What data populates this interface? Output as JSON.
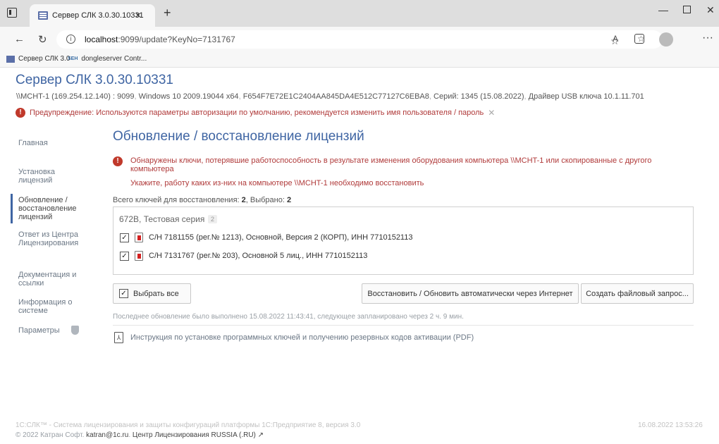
{
  "browser": {
    "tab_title": "Сервер СЛК 3.0.30.10331",
    "tab_close": "×",
    "new_tab": "+",
    "win_min": "—",
    "win_close": "✕",
    "url_host": "localhost",
    "url_rest": ":9099/update?KeyNo=7131767",
    "favorites": [
      {
        "label": "Сервер СЛК 3.0"
      },
      {
        "label": "dongleserver Contr..."
      }
    ]
  },
  "header": {
    "title": "Сервер СЛК 3.0.30.10331",
    "info_host": "\\\\MCHT-1 (169.254.12.140) : 9099",
    "info_os": "Windows 10 2009.19044 x64",
    "info_id": "F654F7E72E1C2404AA845DA4E512C77127C6EBA8",
    "info_serial": "Серий: 1345 (15.08.2022)",
    "info_driver": "Драйвер USB ключа 10.1.11.701",
    "warning": "Предупреждение: Используются параметры авторизации по умолчанию, рекомендуется изменить имя пользователя / пароль"
  },
  "sidebar": {
    "items": [
      {
        "label": "Главная"
      },
      {
        "label": "Установка лицензий"
      },
      {
        "label": "Обновление / восстановление лицензий"
      },
      {
        "label": "Ответ из Центра Лицензирования"
      },
      {
        "label": "Документация и ссылки"
      },
      {
        "label": "Информация о системе"
      },
      {
        "label": "Параметры"
      }
    ]
  },
  "main": {
    "title": "Обновление / восстановление лицензий",
    "alert_text": "Обнаружены ключи, потерявшие работоспособность в результате изменения оборудования компьютера \\\\MCHT-1 или скопированные с другого компьютера",
    "alert_instruction": "Укажите, работу каких из-них на компьютере \\\\MCHT-1 необходимо восстановить",
    "counts_prefix": "Всего ключей для восстановления: ",
    "counts_total": "2",
    "counts_mid": ", Выбрано: ",
    "counts_selected": "2",
    "series_name": "672B, Тестовая серия",
    "series_count": "2",
    "keys": [
      {
        "label": "С/Н 7181155 (рег.№ 1213), Основной, Версия 2 (КОРП), ИНН 7710152113",
        "checked": true
      },
      {
        "label": "С/Н 7131767 (рег.№ 203), Основной 5 лиц., ИНН 7710152113",
        "checked": true
      }
    ],
    "select_all_label": "Выбрать все",
    "restore_button": "Восстановить / Обновить автоматически через Интернет",
    "file_request_button": "Создать файловый запрос...",
    "last_update": "Последнее обновление было выполнено 15.08.2022 11:43:41, следующее запланировано через 2 ч. 9 мин.",
    "pdf_link": "Инструкция по установке программных ключей и получению резервных кодов активации (PDF)"
  },
  "footer": {
    "line1": "1С:СЛК™ - Система лицензирования и защиты конфигураций платформы 1С:Предприятие 8, версия 3.0",
    "date": "16.08.2022 13:53:26",
    "copyright": "© 2022 Катран Софт.",
    "email": "katran@1c.ru",
    "center_label": "Центр Лицензирования RUSSIA (.RU)"
  }
}
